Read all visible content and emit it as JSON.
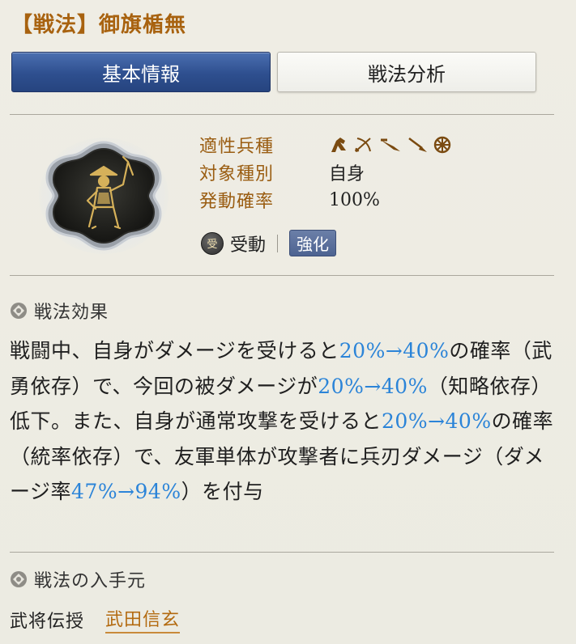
{
  "title": "【戦法】御旗楯無",
  "tabs": [
    {
      "label": "基本情報",
      "active": true
    },
    {
      "label": "戦法分析",
      "active": false
    }
  ],
  "info": {
    "unit_type_label": "適性兵種",
    "unit_type_icons": [
      "cavalry-icon",
      "archer-icon",
      "pike-icon",
      "spear-icon",
      "siege-icon"
    ],
    "target_label": "対象種別",
    "target_value": "自身",
    "rate_label": "発動確率",
    "rate_value": "100%"
  },
  "tags": {
    "passive_icon_char": "受",
    "passive_label": "受動",
    "enhanced_label": "強化"
  },
  "effect_section": {
    "heading": "戦法効果",
    "segments": [
      {
        "text": "戦闘中、自身がダメージを受けると",
        "hl": false
      },
      {
        "text": "20%→40%",
        "hl": true
      },
      {
        "text": "の確率（武勇依存）で、今回の被ダメージが",
        "hl": false
      },
      {
        "text": "20%→40%",
        "hl": true
      },
      {
        "text": "（知略依存）低下。また、自身が通常攻撃を受けると",
        "hl": false
      },
      {
        "text": "20%→40%",
        "hl": true
      },
      {
        "text": "の確率（統率依存）で、友軍単体が攻撃者に兵刃ダメージ（ダメージ率",
        "hl": false
      },
      {
        "text": "47%→94%",
        "hl": true
      },
      {
        "text": "）を付与",
        "hl": false
      }
    ]
  },
  "source_section": {
    "heading": "戦法の入手元",
    "label": "武将伝授",
    "link": "武田信玄"
  },
  "colors": {
    "accent_gold": "#a8620f",
    "highlight_blue": "#2b84d8",
    "tab_active": "#2e4f8f"
  }
}
